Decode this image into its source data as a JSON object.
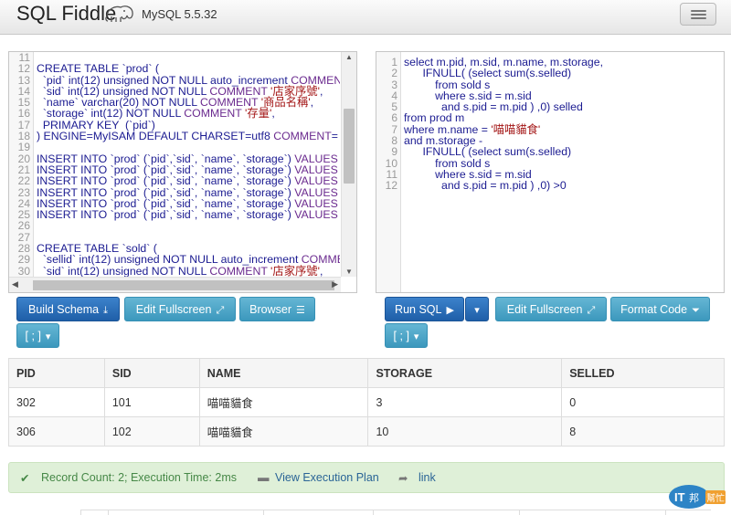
{
  "app": {
    "title": "SQL Fiddle",
    "version": "MySQL 5.5.32"
  },
  "schema_editor": {
    "lines": [
      {
        "n": "11",
        "text": ""
      },
      {
        "n": "12",
        "text": "CREATE TABLE `prod` ("
      },
      {
        "n": "13",
        "text": "  `pid` int(12) unsigned NOT NULL auto_increment COMMENT"
      },
      {
        "n": "14",
        "text": "  `sid` int(12) unsigned NOT NULL COMMENT '店家序號',"
      },
      {
        "n": "15",
        "text": "  `name` varchar(20) NOT NULL COMMENT '商品名稱',"
      },
      {
        "n": "16",
        "text": "  `storage` int(12) NOT NULL COMMENT '存量',"
      },
      {
        "n": "17",
        "text": "  PRIMARY KEY  (`pid`)"
      },
      {
        "n": "18",
        "text": ") ENGINE=MyISAM DEFAULT CHARSET=utf8 COMMENT="
      },
      {
        "n": "19",
        "text": ""
      },
      {
        "n": "20",
        "text": "INSERT INTO `prod` (`pid`,`sid`, `name`, `storage`) VALUES"
      },
      {
        "n": "21",
        "text": "INSERT INTO `prod` (`pid`,`sid`, `name`, `storage`) VALUES"
      },
      {
        "n": "22",
        "text": "INSERT INTO `prod` (`pid`,`sid`, `name`, `storage`) VALUES"
      },
      {
        "n": "23",
        "text": "INSERT INTO `prod` (`pid`,`sid`, `name`, `storage`) VALUES"
      },
      {
        "n": "24",
        "text": "INSERT INTO `prod` (`pid`,`sid`, `name`, `storage`) VALUES"
      },
      {
        "n": "25",
        "text": "INSERT INTO `prod` (`pid`,`sid`, `name`, `storage`) VALUES"
      },
      {
        "n": "26",
        "text": ""
      },
      {
        "n": "27",
        "text": ""
      },
      {
        "n": "28",
        "text": "CREATE TABLE `sold` ("
      },
      {
        "n": "29",
        "text": "  `sellid` int(12) unsigned NOT NULL auto_increment COMMENT"
      },
      {
        "n": "30",
        "text": "  `sid` int(12) unsigned NOT NULL COMMENT '店家序號',"
      }
    ]
  },
  "query_editor": {
    "lines": [
      {
        "n": "1",
        "text": "select m.pid, m.sid, m.name, m.storage,"
      },
      {
        "n": "2",
        "text": "      IFNULL( (select sum(s.selled)"
      },
      {
        "n": "3",
        "text": "          from sold s"
      },
      {
        "n": "4",
        "text": "          where s.sid = m.sid"
      },
      {
        "n": "5",
        "text": "            and s.pid = m.pid ) ,0) selled"
      },
      {
        "n": "6",
        "text": "from prod m"
      },
      {
        "n": "7",
        "text": "where m.name = '喵喵貓食'"
      },
      {
        "n": "8",
        "text": "and m.storage -"
      },
      {
        "n": "9",
        "text": "      IFNULL( (select sum(s.selled)"
      },
      {
        "n": "10",
        "text": "          from sold s"
      },
      {
        "n": "11",
        "text": "          where s.sid = m.sid"
      },
      {
        "n": "12",
        "text": "            and s.pid = m.pid ) ,0) >0"
      }
    ]
  },
  "schema_toolbar": {
    "build_schema": "Build Schema",
    "edit_fullscreen": "Edit Fullscreen",
    "browser": "Browser",
    "delimiter": "[ ; ]"
  },
  "query_toolbar": {
    "run_sql": "Run SQL",
    "edit_fullscreen": "Edit Fullscreen",
    "format_code": "Format Code",
    "delimiter": "[ ; ]"
  },
  "results": {
    "columns": [
      "PID",
      "SID",
      "NAME",
      "STORAGE",
      "SELLED"
    ],
    "rows": [
      [
        "302",
        "101",
        "喵喵貓食",
        "3",
        "0"
      ],
      [
        "306",
        "102",
        "喵喵貓食",
        "10",
        "8"
      ]
    ]
  },
  "status": {
    "record_info": "Record Count: 2; Execution Time: 2ms",
    "view_plan": "View Execution Plan",
    "link": "link"
  },
  "colors": {
    "primary": "#2a6db5",
    "info": "#4aa6c9",
    "success_bg": "#dff0d8",
    "success_text": "#468847"
  },
  "icons": [
    "elephant-logo-icon",
    "menu-icon",
    "download-icon",
    "expand-icon",
    "browser-icon",
    "play-icon",
    "caret-down-icon",
    "filter-icon",
    "check-icon",
    "minus-icon",
    "share-icon",
    "watermark-logo"
  ]
}
